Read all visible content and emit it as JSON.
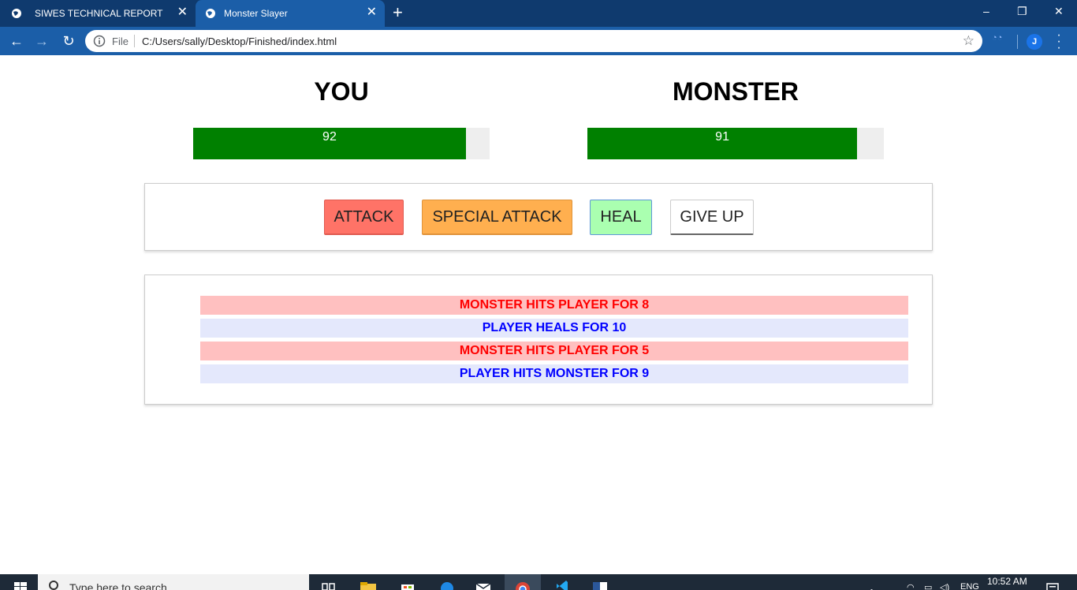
{
  "browser": {
    "tabs": [
      {
        "title": "SIWES TECHNICAL REPORT",
        "active": false
      },
      {
        "title": "Monster Slayer",
        "active": true
      }
    ],
    "new_tab_label": "+",
    "address": {
      "scheme_label": "File",
      "url": "C:/Users/sally/Desktop/Finished/index.html"
    },
    "profile_initial": "J",
    "window_controls": {
      "minimize": "–",
      "restore": "❐",
      "close": "✕"
    }
  },
  "game": {
    "player": {
      "title": "YOU",
      "health": 92
    },
    "monster": {
      "title": "MONSTER",
      "health": 91
    },
    "max_health": 100,
    "controls": {
      "attack_label": "ATTACK",
      "special_attack_label": "SPECIAL ATTACK",
      "heal_label": "HEAL",
      "give_up_label": "GIVE UP"
    },
    "log": [
      {
        "text": "MONSTER HITS PLAYER FOR 8",
        "actor": "monster"
      },
      {
        "text": "PLAYER HEALS FOR 10",
        "actor": "player"
      },
      {
        "text": "MONSTER HITS PLAYER FOR 5",
        "actor": "monster"
      },
      {
        "text": "PLAYER HITS MONSTER FOR 9",
        "actor": "player"
      }
    ],
    "colors": {
      "health_fill": "#008000",
      "attack": "#ff7367",
      "special_attack": "#ffaf4f",
      "heal": "#aaffb0",
      "log_monster_bg": "#ffc0c0",
      "log_player_bg": "#e4e8fc"
    }
  },
  "taskbar": {
    "search_placeholder": "Type here to search",
    "clock_time": "10:52 AM",
    "language": "ENG"
  }
}
